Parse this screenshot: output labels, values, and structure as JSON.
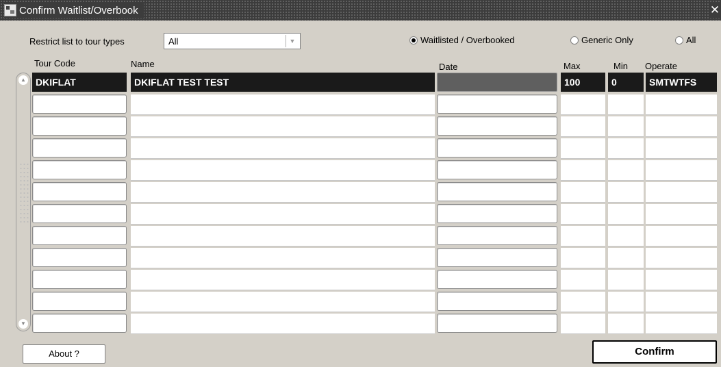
{
  "window": {
    "title": "Confirm Waitlist/Overbook",
    "close_glyph": "✕",
    "icon": "forms-app-icon"
  },
  "filter": {
    "restrict_label": "Restrict list to tour types",
    "tour_type_value": "All",
    "radios": [
      {
        "label": "Waitlisted / Overbooked",
        "selected": true
      },
      {
        "label": "Generic Only",
        "selected": false
      },
      {
        "label": "All",
        "selected": false
      }
    ]
  },
  "columns": {
    "tour_code": "Tour Code",
    "name": "Name",
    "date": "Date",
    "max": "Max",
    "min": "Min",
    "operate": "Operate"
  },
  "rows": [
    {
      "tour_code": "DKIFLAT",
      "name": "DKIFLAT TEST TEST",
      "date": "",
      "max": "100",
      "min": "0",
      "operate": "SMTWTFS",
      "selected": true
    },
    {
      "tour_code": "",
      "name": "",
      "date": "",
      "max": "",
      "min": "",
      "operate": ""
    },
    {
      "tour_code": "",
      "name": "",
      "date": "",
      "max": "",
      "min": "",
      "operate": ""
    },
    {
      "tour_code": "",
      "name": "",
      "date": "",
      "max": "",
      "min": "",
      "operate": ""
    },
    {
      "tour_code": "",
      "name": "",
      "date": "",
      "max": "",
      "min": "",
      "operate": ""
    },
    {
      "tour_code": "",
      "name": "",
      "date": "",
      "max": "",
      "min": "",
      "operate": ""
    },
    {
      "tour_code": "",
      "name": "",
      "date": "",
      "max": "",
      "min": "",
      "operate": ""
    },
    {
      "tour_code": "",
      "name": "",
      "date": "",
      "max": "",
      "min": "",
      "operate": ""
    },
    {
      "tour_code": "",
      "name": "",
      "date": "",
      "max": "",
      "min": "",
      "operate": ""
    },
    {
      "tour_code": "",
      "name": "",
      "date": "",
      "max": "",
      "min": "",
      "operate": ""
    },
    {
      "tour_code": "",
      "name": "",
      "date": "",
      "max": "",
      "min": "",
      "operate": ""
    },
    {
      "tour_code": "",
      "name": "",
      "date": "",
      "max": "",
      "min": "",
      "operate": ""
    }
  ],
  "scrollbar": {
    "up_glyph": "▲",
    "down_glyph": "▼"
  },
  "buttons": {
    "about": "About ?",
    "confirm": "Confirm"
  },
  "icons": {
    "select_arrow": "▼"
  }
}
